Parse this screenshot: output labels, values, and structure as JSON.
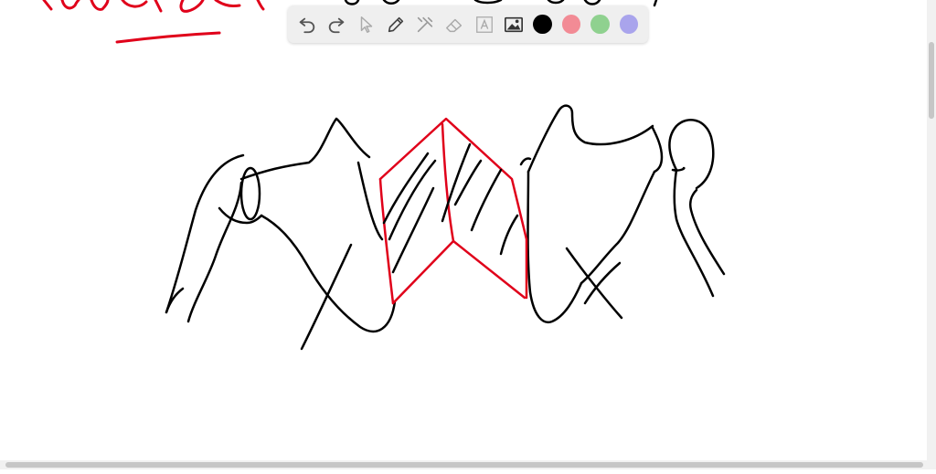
{
  "canvas": {
    "ink_colors": {
      "black": "#000000",
      "red": "#e0001a"
    }
  },
  "toolbar": {
    "tools": [
      {
        "name": "undo",
        "icon": "undo-icon"
      },
      {
        "name": "redo",
        "icon": "redo-icon"
      },
      {
        "name": "select",
        "icon": "cursor-icon"
      },
      {
        "name": "pen",
        "icon": "pencil-icon"
      },
      {
        "name": "tools",
        "icon": "tools-icon"
      },
      {
        "name": "eraser",
        "icon": "eraser-icon"
      },
      {
        "name": "text",
        "icon": "text-icon"
      },
      {
        "name": "image",
        "icon": "image-icon"
      }
    ],
    "colors": [
      {
        "name": "black",
        "hex": "#000000",
        "selected": true
      },
      {
        "name": "red",
        "hex": "#f28b95",
        "selected": false
      },
      {
        "name": "green",
        "hex": "#8fd18f",
        "selected": false
      },
      {
        "name": "purple",
        "hex": "#a9a4ec",
        "selected": false
      }
    ]
  }
}
